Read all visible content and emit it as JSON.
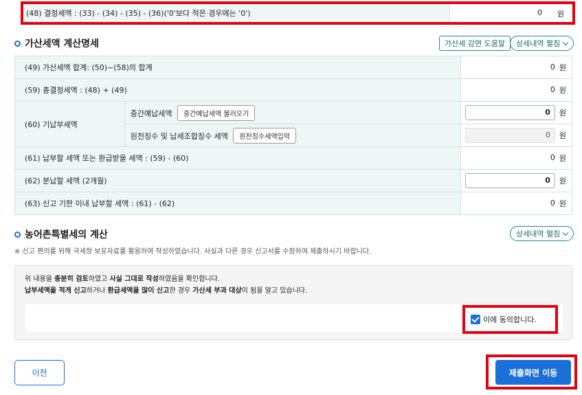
{
  "row48": {
    "label": "(48) 결정세액 : (33) - (34) - (35) - (36)('0'보다 적은 경우에는 '0')",
    "value": "0",
    "unit": "원"
  },
  "section_penalty": {
    "title": "가산세액 계산명세",
    "help_button": "가산세 감면 도움말",
    "detail_button": "상세내역 펼침"
  },
  "rows": {
    "r49": {
      "label": "(49) 가산세액 합계: (50)~(58)의 합계",
      "value": "0",
      "unit": "원"
    },
    "r59": {
      "label": "(59) 총결정세액 : (48) + (49)",
      "value": "0",
      "unit": "원"
    },
    "r60": {
      "label": "(60) 기납부세액",
      "sub1": {
        "label": "중간예납세액",
        "button": "중간예납세액 불러오기",
        "value": "0",
        "unit": "원"
      },
      "sub2": {
        "label": "원천징수 및 납세조합징수 세액",
        "button": "원천징수세액입력",
        "value": "0",
        "unit": "원"
      }
    },
    "r61": {
      "label": "(61) 납부할 세액 또는 환급받을 세액 : (59) - (60)",
      "value": "0",
      "unit": "원"
    },
    "r62": {
      "label": "(62) 분납할 세액 (2개월)",
      "value": "0",
      "unit": "원"
    },
    "r63": {
      "label": "(63) 신고 기한 이내 납부할 세액 : (61) - (62)",
      "value": "0",
      "unit": "원"
    }
  },
  "section_rural": {
    "title": "농어촌특별세의 계산",
    "detail_button": "상세내역 펼침"
  },
  "notice": "※ 신고 편의를 위해 국세청 보유자료를 활용하여 작성하였습니다. 사실과 다른 경우 신고서를 수정하여 제출하시기 바랍니다.",
  "agree": {
    "line1_a": "위 내용을 ",
    "line1_b": "충분히 검토",
    "line1_c": "하였고 ",
    "line1_d": "사실 그대로 작성",
    "line1_e": "하였음을 확인합니다.",
    "line2_a": "납부세액을 적게 신고",
    "line2_b": "하거나 ",
    "line2_c": "환급세액을 많이 신고",
    "line2_d": "한 경우 ",
    "line2_e": "가산세 부과 대상",
    "line2_f": "이 됨을 알고 있습니다.",
    "checkbox_label": "이에 동의합니다.",
    "checked": true
  },
  "buttons": {
    "prev": "이전",
    "submit": "제출화면 이동"
  },
  "colors": {
    "accent": "#1a6fd9",
    "highlight": "#e60012",
    "teal": "#1a8f86"
  }
}
